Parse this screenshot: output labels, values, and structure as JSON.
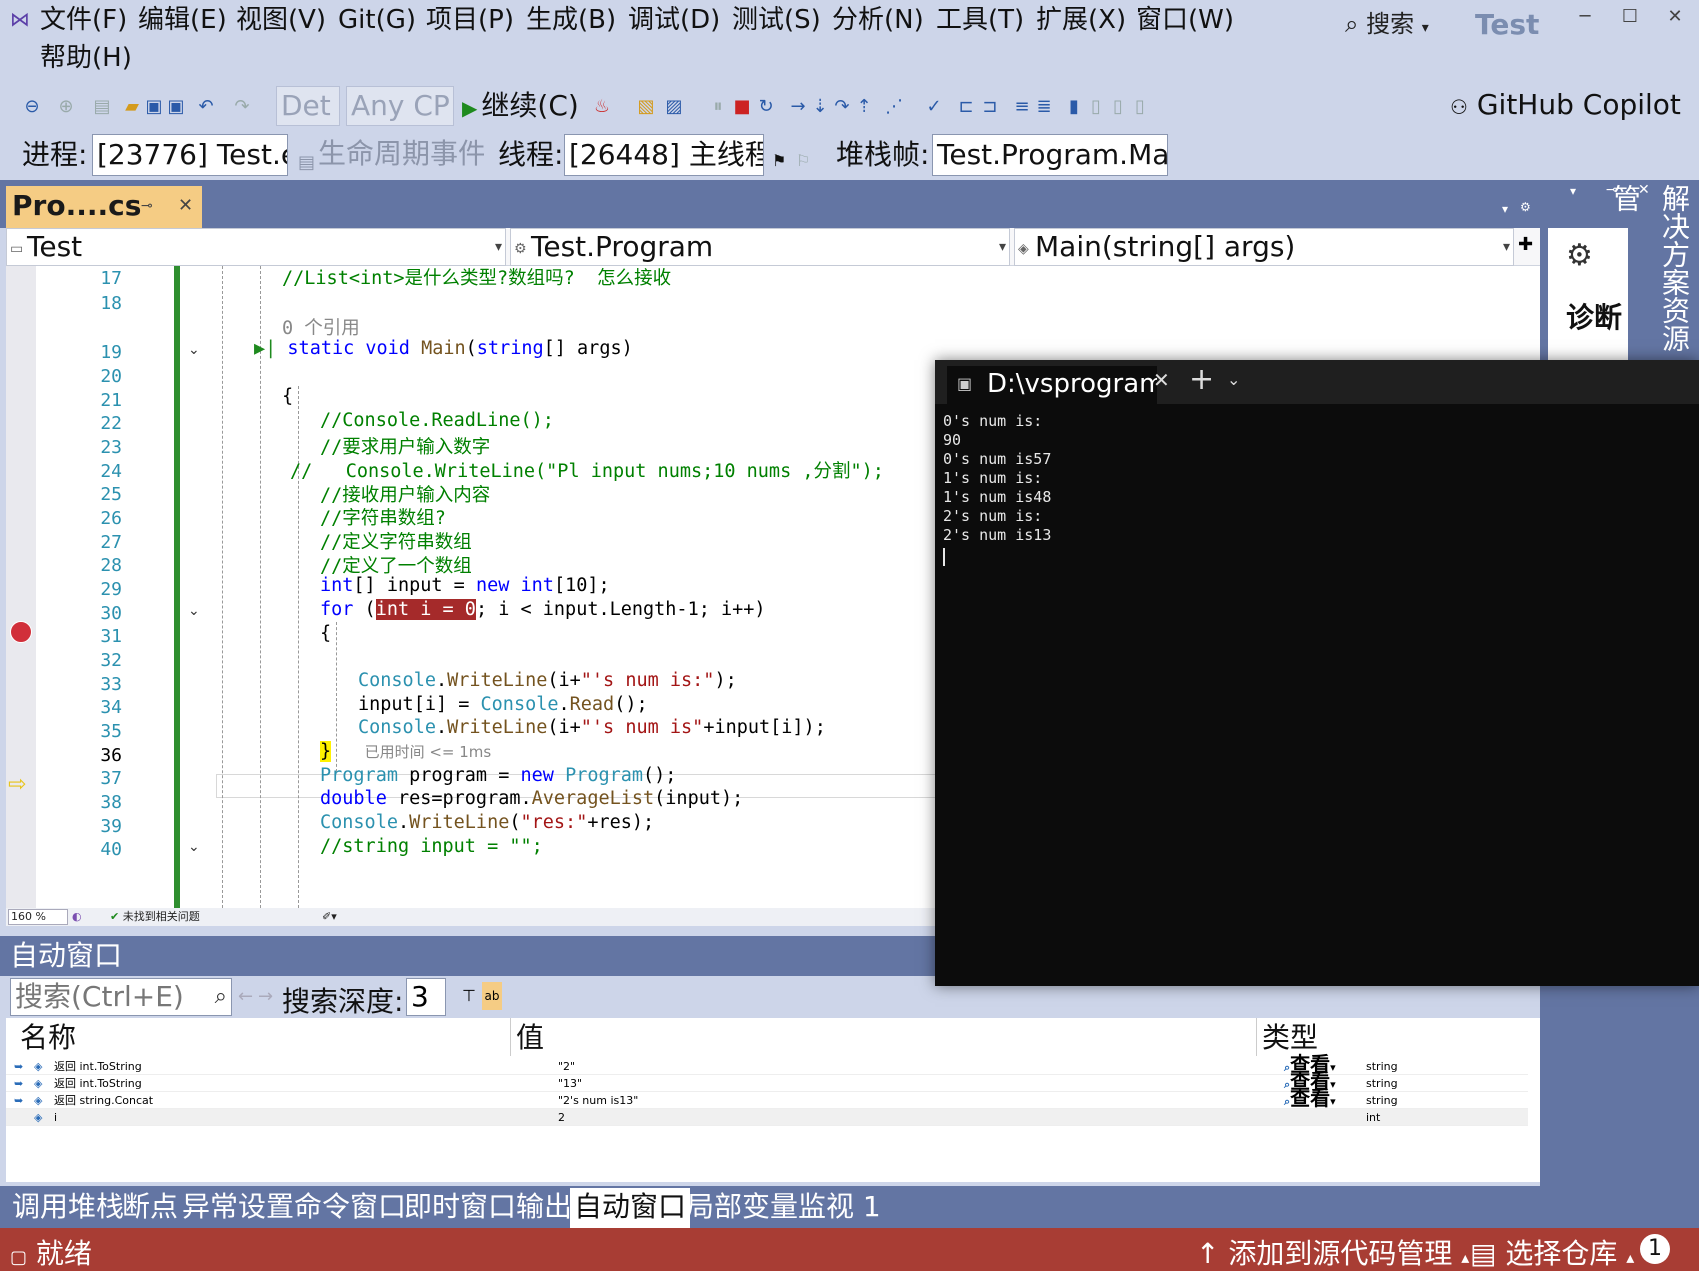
{
  "menu": {
    "items": [
      "文件(F)",
      "编辑(E)",
      "视图(V)",
      "Git(G)",
      "项目(P)",
      "生成(B)",
      "调试(D)",
      "测试(S)",
      "分析(N)",
      "工具(T)",
      "扩展(X)",
      "窗口(W)"
    ],
    "help": "帮助(H)",
    "search": "搜索",
    "app_title": "Test",
    "copilot": "GitHub Copilot"
  },
  "toolbar": {
    "config": "Det",
    "platform": "Any CP",
    "continue": "继续(C)"
  },
  "debug": {
    "process_label": "进程:",
    "process_value": "[23776] Test.e",
    "lifecycle": "生命周期事件",
    "thread_label": "线程:",
    "thread_value": "[26448] 主线程",
    "stack_label": "堆栈帧:",
    "stack_value": "Test.Program.Ma"
  },
  "editor": {
    "tab_title": "Pro....cs",
    "nav_project": "Test",
    "nav_class": "Test.Program",
    "nav_member": "Main(string[] args)",
    "zoom": "160 %",
    "issues": "未找到相关问题",
    "line_numbers": [
      "17",
      "18",
      "19",
      "20",
      "21",
      "22",
      "23",
      "24",
      "25",
      "26",
      "27",
      "28",
      "29",
      "30",
      "31",
      "32",
      "33",
      "34",
      "35",
      "36",
      "37",
      "38",
      "39",
      "40"
    ],
    "ref_count": "0 个引用",
    "elapsed": "已用时间 <= 1ms"
  },
  "terminal": {
    "tab_title": "D:\\vsprogram",
    "output": "0's num is:\n90\n0's num is57\n1's num is:\n1's num is48\n2's num is:\n2's num is13"
  },
  "autos": {
    "title": "自动窗口",
    "search_placeholder": "搜索(Ctrl+E)",
    "depth_label": "搜索深度:",
    "depth_value": "3",
    "col_name": "名称",
    "col_value": "值",
    "col_type": "类型",
    "look_label": "查看",
    "rows": [
      {
        "name": "返回 int.ToString",
        "value": "\"2\"",
        "type": "string"
      },
      {
        "name": "返回 int.ToString",
        "value": "\"13\"",
        "type": "string"
      },
      {
        "name": "返回 string.Concat",
        "value": "\"2's num is13\"",
        "type": "string"
      },
      {
        "name": "i",
        "value": "2",
        "type": "int"
      }
    ]
  },
  "right_panel": {
    "solution_tab": "解决方案资源管",
    "diag_label": "诊断"
  },
  "bottom_tabs": [
    "调用堆栈",
    "断点",
    "异常设置",
    "命令窗口",
    "即时窗口",
    "输出",
    "自动窗口",
    "局部变量",
    "监视 1"
  ],
  "status": {
    "ready": "就绪",
    "source_control": "添加到源代码管理",
    "repo": "选择仓库",
    "notifications": "1"
  },
  "colors": {
    "accent": "#6375a3",
    "status_bar": "#a83d34",
    "breakpoint": "#d12f3a",
    "active_tab": "#f5cc84"
  }
}
